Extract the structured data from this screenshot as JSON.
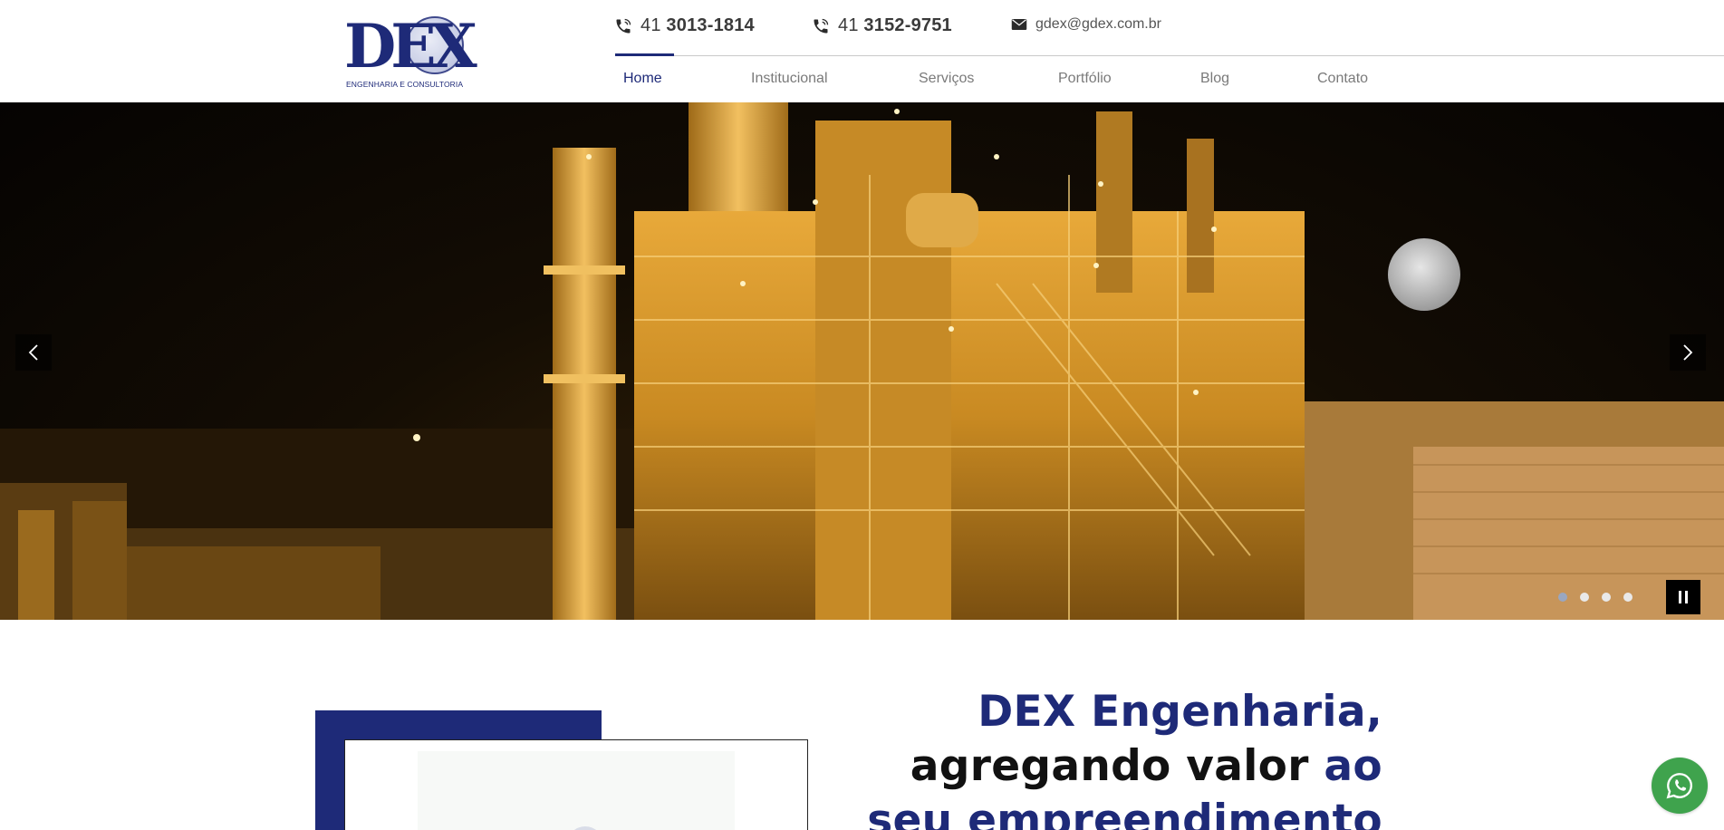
{
  "brand": {
    "logo_text": "DEX",
    "logo_subtitle": "ENGENHARIA E CONSULTORIA",
    "primary_color": "#1e2a78"
  },
  "contacts": {
    "phone1": {
      "ddd": "41",
      "number": "3013-1814",
      "icon": "phone-icon"
    },
    "phone2": {
      "ddd": "41",
      "number": "3152-9751",
      "icon": "phone-icon"
    },
    "email": {
      "text": "gdex@gdex.com.br",
      "icon": "mail-icon"
    }
  },
  "nav": {
    "items": [
      {
        "label": "Home",
        "active": true
      },
      {
        "label": "Institucional"
      },
      {
        "label": "Serviços"
      },
      {
        "label": "Portfólio"
      },
      {
        "label": "Blog"
      },
      {
        "label": "Contato"
      }
    ]
  },
  "slider": {
    "image_subject": "industrial plant at night with moon",
    "prev_icon": "chevron-left-icon",
    "next_icon": "chevron-right-icon",
    "pause_icon": "pause-icon",
    "slide_count": 4,
    "active_slide": 1
  },
  "about": {
    "headline_line1": "DEX Engenharia,",
    "headline_line2_black": "agregando valor ",
    "headline_line2_blue": "ao",
    "headline_line3": "seu empreendimento"
  },
  "whatsapp": {
    "icon": "whatsapp-icon",
    "color": "#3fa34d"
  }
}
